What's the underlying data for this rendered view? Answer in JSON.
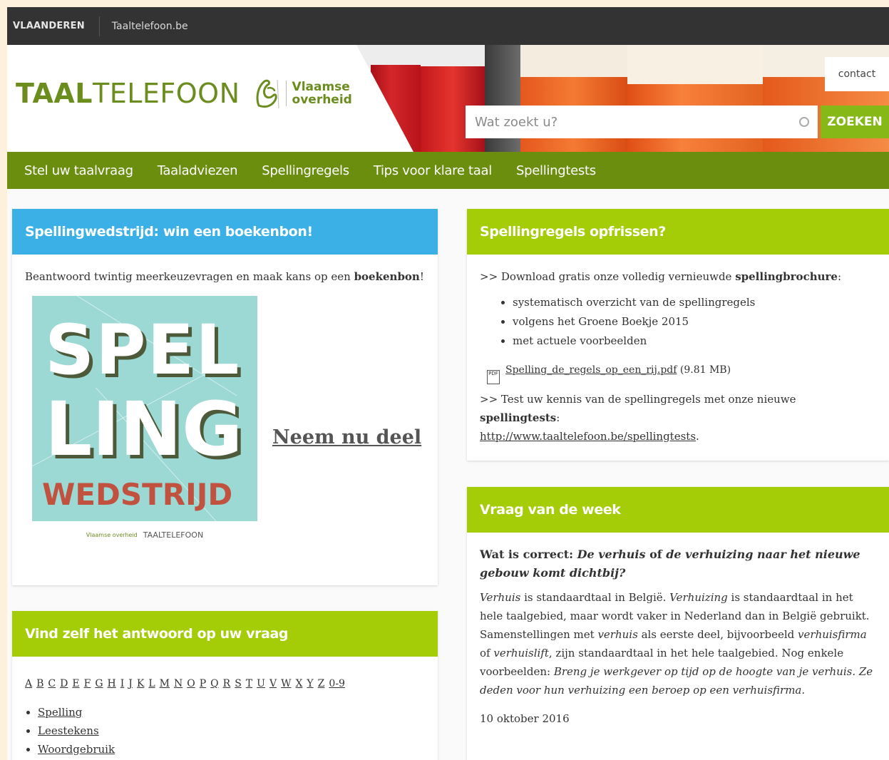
{
  "topbar": {
    "flag": "VLAANDEREN",
    "site": "Taaltelefoon.be"
  },
  "header": {
    "logo_bold": "TAAL",
    "logo_rest": "TELEFOON",
    "logo_sub_1": "Vlaamse",
    "logo_sub_2": "overheid",
    "contact": "contact",
    "search_placeholder": "Wat zoekt u?",
    "search_button": "ZOEKEN"
  },
  "nav": [
    "Stel uw taalvraag",
    "Taaladviezen",
    "Spellingregels",
    "Tips voor klare taal",
    "Spellingtests"
  ],
  "contest": {
    "title": "Spellingwedstrijd: win een boekenbon!",
    "text_before": "Beantwoord twintig meerkeuzevragen en maak kans op een ",
    "text_bold": "boekenbon",
    "text_after": "!",
    "poster_line1": "SPEL",
    "poster_line2": "LING",
    "poster_line3": "WEDSTRIJD",
    "poster_footer_small": "Vlaamse overheid",
    "poster_footer": "TAALTELEFOON",
    "cta": "Neem nu deel"
  },
  "find": {
    "title": "Vind zelf het antwoord op uw vraag",
    "letters": [
      "A",
      "B",
      "C",
      "D",
      "E",
      "F",
      "G",
      "H",
      "I",
      "J",
      "K",
      "L",
      "M",
      "N",
      "O",
      "P",
      "Q",
      "R",
      "S",
      "T",
      "U",
      "V",
      "W",
      "X",
      "Y",
      "Z",
      "0-9"
    ],
    "links": [
      "Spelling",
      "Leestekens",
      "Woordgebruik"
    ]
  },
  "spelling": {
    "title": "Spellingregels opfrissen?",
    "intro_before": ">> Download gratis onze volledig vernieuwde ",
    "intro_bold": "spellingbrochure",
    "intro_after": ":",
    "bullets": [
      "systematisch overzicht van de spellingregels",
      "volgens het Groene Boekje 2015",
      "met actuele voorbeelden"
    ],
    "pdf_link": "Spelling_de_regels_op_een_rij.pdf",
    "pdf_size": " (9.81 MB)",
    "test_before": ">> Test uw kennis van de spellingregels met onze nieuwe ",
    "test_bold": "spellingtests",
    "test_after": ":",
    "test_url": "http://www.taaltelefoon.be/spellingtests",
    "test_dot": "."
  },
  "week": {
    "title": "Vraag van de week",
    "q_prefix": "Wat is correct: ",
    "q_it1": "De verhuis",
    "q_mid": " of ",
    "q_it2": "de verhuizing naar het nieuwe gebouw komt dichtbij?",
    "a_it1": "Verhuis",
    "a_t1": " is standaardtaal in België. ",
    "a_it2": "Verhuizing",
    "a_t2": " is standaardtaal in het hele taalgebied, maar wordt vaker in Nederland dan in België gebruikt. Samenstellingen met ",
    "a_it3": "verhuis",
    "a_t3": " als eerste deel, bijvoorbeeld ",
    "a_it4": "verhuisfirma",
    "a_t4": " of ",
    "a_it5": "verhuislift",
    "a_t5": ", zijn standaardtaal in het hele taalgebied. Nog enkele voorbeelden: ",
    "a_it6": "Breng je werkgever op tijd op de hoogte van je verhuis. Ze deden voor hun verhuizing een beroep op een verhuisfirma.",
    "date": "10 oktober 2016"
  },
  "colors": {
    "nav_green": "#6b8e0f",
    "card_green": "#a4cc07",
    "card_blue": "#3ab0e7",
    "topbar": "#333333"
  }
}
